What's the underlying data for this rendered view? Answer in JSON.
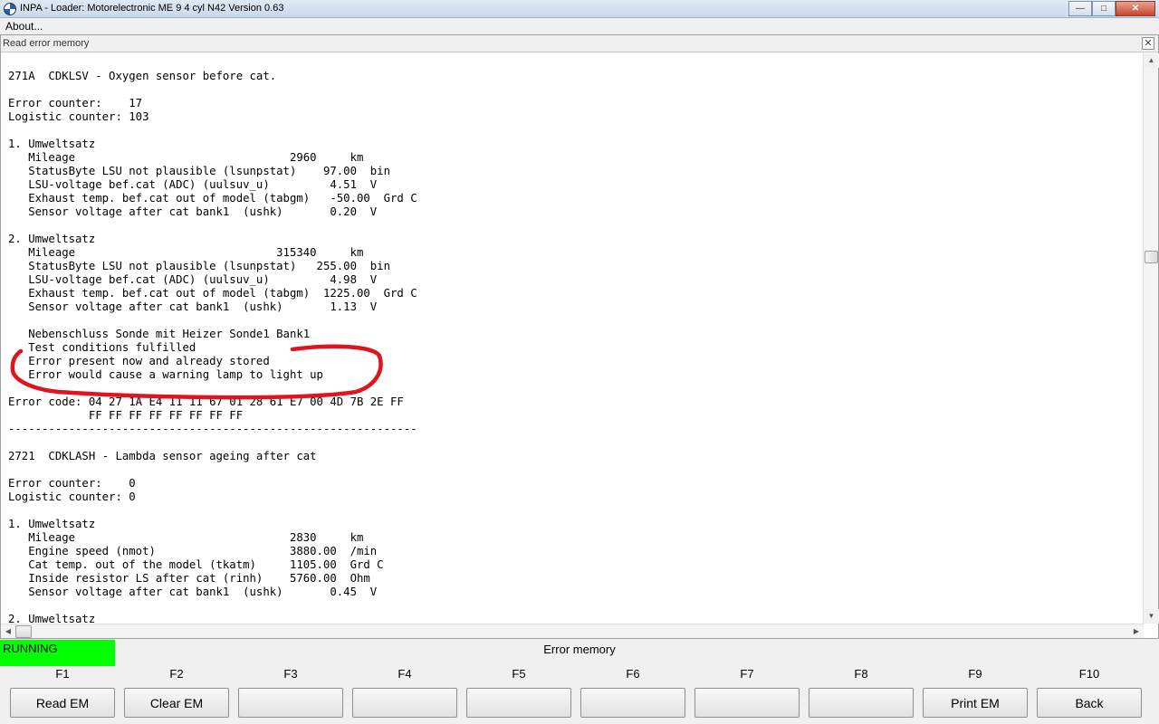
{
  "window": {
    "title": "INPA - Loader:  Motorelectronic ME 9  4 cyl N42 Version 0.63"
  },
  "menu": {
    "about": "About..."
  },
  "child": {
    "title": "Read error memory"
  },
  "report_text": "271A  CDKLSV - Oxygen sensor before cat.\n\nError counter:    17\nLogistic counter: 103\n\n1. Umweltsatz\n   Mileage                                2960     km\n   StatusByte LSU not plausible (lsunpstat)    97.00  bin\n   LSU-voltage bef.cat (ADC) (uulsuv_u)         4.51  V\n   Exhaust temp. bef.cat out of model (tabgm)   -50.00  Grd C\n   Sensor voltage after cat bank1  (ushk)       0.20  V\n\n2. Umweltsatz\n   Mileage                              315340     km\n   StatusByte LSU not plausible (lsunpstat)   255.00  bin\n   LSU-voltage bef.cat (ADC) (uulsuv_u)         4.98  V\n   Exhaust temp. bef.cat out of model (tabgm)  1225.00  Grd C\n   Sensor voltage after cat bank1  (ushk)       1.13  V\n\n   Nebenschluss Sonde mit Heizer Sonde1 Bank1\n   Test conditions fulfilled\n   Error present now and already stored\n   Error would cause a warning lamp to light up\n\nError code: 04 27 1A E4 11 11 67 01 28 61 E7 00 4D 7B 2E FF\n            FF FF FF FF FF FF FF FF\n-------------------------------------------------------------\n\n2721  CDKLASH - Lambda sensor ageing after cat\n\nError counter:    0\nLogistic counter: 0\n\n1. Umweltsatz\n   Mileage                                2830     km\n   Engine speed (nmot)                    3880.00  /min\n   Cat temp. out of the model (tkatm)     1105.00  Grd C\n   Inside resistor LS after cat (rinh)    5760.00  Ohm\n   Sensor voltage after cat bank1  (ushk)       0.45  V\n\n2. Umweltsatz",
  "status": {
    "text": "RUNNING",
    "color": "#00ff00"
  },
  "panel_title": "Error memory",
  "fkeys": [
    {
      "key": "F1",
      "label": "Read EM"
    },
    {
      "key": "F2",
      "label": "Clear EM"
    },
    {
      "key": "F3",
      "label": ""
    },
    {
      "key": "F4",
      "label": ""
    },
    {
      "key": "F5",
      "label": ""
    },
    {
      "key": "F6",
      "label": ""
    },
    {
      "key": "F7",
      "label": ""
    },
    {
      "key": "F8",
      "label": ""
    },
    {
      "key": "F9",
      "label": "Print EM"
    },
    {
      "key": "F10",
      "label": "Back"
    }
  ],
  "annotation_color": "#e0141e"
}
